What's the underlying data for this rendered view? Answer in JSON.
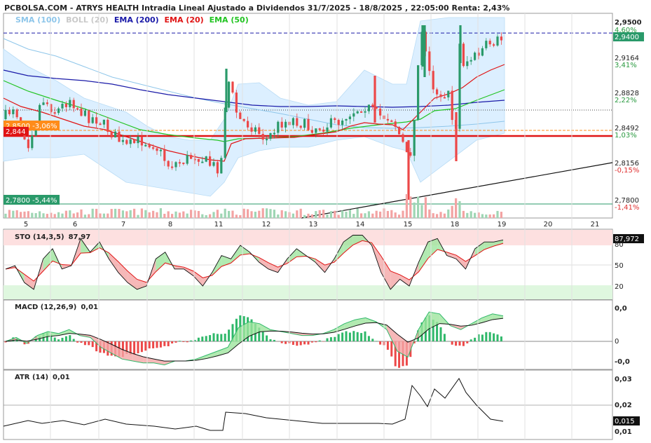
{
  "chart_data": {
    "type": "line",
    "title": "PCBOLSA.COM - ATRYS HEALTH Intradia Lineal Ajustado a Dividendos 31/7/2025 - 18/8/2025 , 22:05:00 Renta: 2,43%",
    "legend": [
      {
        "label": "SMA (100)",
        "color": "#8ec6ea"
      },
      {
        "label": "BOLL (20)",
        "color": "#c9c9c9"
      },
      {
        "label": "EMA (200)",
        "color": "#1a1aa8"
      },
      {
        "label": "EMA (20)",
        "color": "#e01414"
      },
      {
        "label": "EMA (50)",
        "color": "#22c422"
      }
    ],
    "x_ticks": [
      "5",
      "6",
      "7",
      "8",
      "11",
      "12",
      "13",
      "14",
      "15",
      "18",
      "19",
      "20",
      "21"
    ],
    "price": {
      "ylim": [
        2.776,
        2.962
      ],
      "y_ticks": [
        "2,9500",
        "2,9164",
        "2,8828",
        "2,8492",
        "2,8156",
        "2,7800"
      ],
      "y_pcts": [
        "4,60%",
        "3,41%",
        "2,22%",
        "1,03%",
        "-0,15%",
        "-1,41%"
      ],
      "last_price": "2,9400",
      "ref_label": "2,8500 -3,06%",
      "red_line_label": "2,844",
      "low_label": "2,7800 -5,44%"
    },
    "stochastic": {
      "label": "STO (14,3,5)",
      "value": "87,97",
      "last": "87,972",
      "y_ticks": [
        "80",
        "50",
        "20"
      ]
    },
    "macd": {
      "label": "MACD (12,26,9)",
      "value": "0,01",
      "y_ticks": [
        "0,0",
        "0",
        "-0,0"
      ]
    },
    "atr": {
      "label": "ATR (14)",
      "value": "0,01",
      "last": "0,015",
      "y_ticks": [
        "0,03",
        "0,02",
        "0,01"
      ]
    },
    "colors": {
      "up": "#2a9a6a",
      "down": "#ec4848",
      "boll_fill": "#dcefff",
      "bull_zone": "#dff7df",
      "bear_zone": "#fde0e0"
    }
  }
}
